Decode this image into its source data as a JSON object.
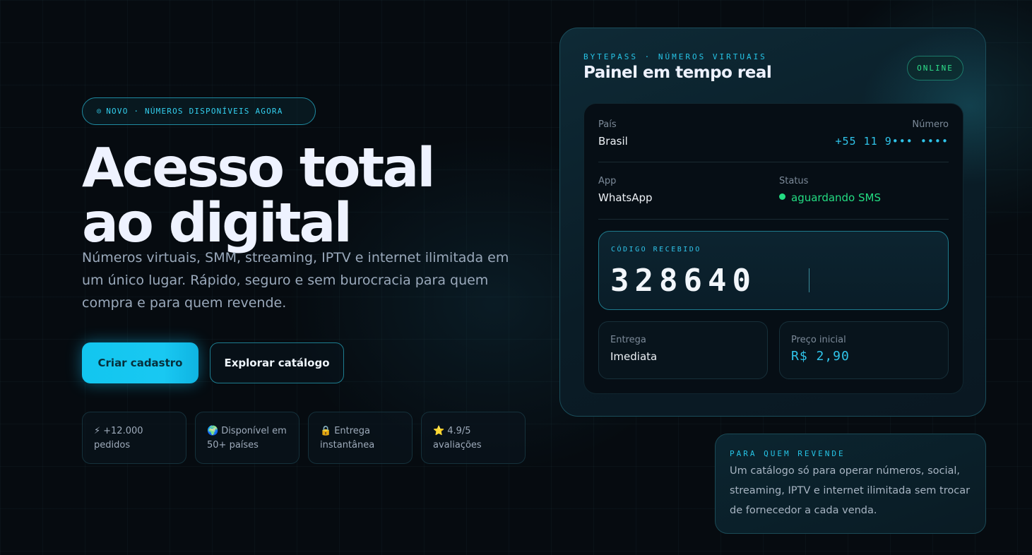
{
  "hero": {
    "badge": "NOVO · NÚMEROS DISPONÍVEIS AGORA",
    "headline_line1": "Acesso total",
    "headline_line2": "ao digital",
    "lede": "Números virtuais, SMM, streaming, IPTV e internet ilimitada em um único lugar. Rápido, seguro e sem burocracia para quem compra e para quem revende.",
    "primary_cta": "Criar cadastro",
    "secondary_cta": "Explorar catálogo",
    "stats": [
      {
        "icon": "lightning-icon",
        "glyph": "⚡",
        "line1": "+12.000",
        "line2": "pedidos"
      },
      {
        "icon": "globe-icon",
        "glyph": "🌍",
        "line1": "Disponível em",
        "line2": "50+ países"
      },
      {
        "icon": "lock-icon",
        "glyph": "🔒",
        "line1": "Entrega",
        "line2": "instantânea"
      },
      {
        "icon": "star-icon",
        "glyph": "⭐",
        "line1": "4.9/5",
        "line2": "avaliações"
      }
    ]
  },
  "panel": {
    "kicker": "BYTEPASS · NÚMEROS VIRTUAIS",
    "title": "Painel em tempo real",
    "status_pill": "ONLINE",
    "country_label": "País",
    "country_value": "Brasil",
    "number_label": "Número",
    "number_value": "+55 11 9••• ••••",
    "app_label": "App",
    "app_value": "WhatsApp",
    "status_label": "Status",
    "status_value": "aguardando SMS",
    "code_label": "CÓDIGO RECEBIDO",
    "code_value": "328640",
    "delivery_label": "Entrega",
    "delivery_value": "Imediata",
    "price_label": "Preço inicial",
    "price_value": "R$ 2,90"
  },
  "reseller": {
    "kicker": "PARA QUEM REVENDE",
    "text": "Um catálogo só para operar números, social, streaming, IPTV e internet ilimitada sem trocar de fornecedor a cada venda."
  },
  "colors": {
    "accent": "#19c8f2",
    "success": "#23dc82",
    "background": "#060b10"
  }
}
